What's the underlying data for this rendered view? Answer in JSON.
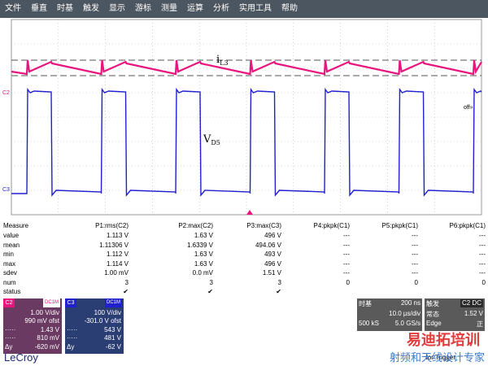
{
  "menu": [
    "文件",
    "垂直",
    "时基",
    "触发",
    "显示",
    "游标",
    "测量",
    "运算",
    "分析",
    "实用工具",
    "帮助"
  ],
  "waveform": {
    "label_current": "i",
    "label_current_sub": "L3",
    "label_voltage": "V",
    "label_voltage_sub": "D5",
    "ch2_marker": "C2",
    "ch3_marker": "C3",
    "offscreen_marker": "off",
    "colors": {
      "ch2": "#e8157e",
      "ch3": "#2020d0",
      "grid": "#808080",
      "dashed": "#555555",
      "trigger": "#e8157e"
    }
  },
  "measure": {
    "header": [
      "Measure",
      "P1:rms(C2)",
      "P2:max(C2)",
      "P3:max(C3)",
      "P4:pkpk(C1)",
      "P5:pkpk(C1)",
      "P6:pkpk(C1)"
    ],
    "rows": [
      [
        "value",
        "1.113 V",
        "1.63 V",
        "496 V",
        "---",
        "---",
        "---"
      ],
      [
        "mean",
        "1.11306 V",
        "1.6339 V",
        "494.06 V",
        "---",
        "---",
        "---"
      ],
      [
        "min",
        "1.112 V",
        "1.63 V",
        "493 V",
        "---",
        "---",
        "---"
      ],
      [
        "max",
        "1.114 V",
        "1.63 V",
        "496 V",
        "---",
        "---",
        "---"
      ],
      [
        "sdev",
        "1.00 mV",
        "0.0 mV",
        "1.51 V",
        "---",
        "---",
        "---"
      ],
      [
        "num",
        "3",
        "3",
        "3",
        "0",
        "0",
        "0"
      ],
      [
        "status",
        "✔",
        "✔",
        "✔",
        "",
        "",
        ""
      ]
    ]
  },
  "channels": {
    "c2": {
      "tag": "C2",
      "coupling": "DC1M",
      "vdiv": "1.00 V/div",
      "offset": "990 mV ofst",
      "r1_label": "·····",
      "r1": "1.43 V",
      "r2_label": "·····",
      "r2": "810 mV",
      "r3_label": "Δy",
      "r3": "-620 mV",
      "bg": "#6b3a63",
      "tag_bg": "#e8157e"
    },
    "c3": {
      "tag": "C3",
      "coupling": "DC1M",
      "vdiv": "100 V/div",
      "offset": "-301.0 V ofst",
      "r1_label": "·····",
      "r1": "543 V",
      "r2_label": "·····",
      "r2": "481 V",
      "r3_label": "Δy",
      "r3": "-62 V",
      "bg": "#2a3e74",
      "tag_bg": "#2020d0"
    }
  },
  "timebase": {
    "title": "时基",
    "value": "200 ns",
    "tdiv": "10.0 µs/div",
    "samples": "500 kS",
    "rate": "5.0 GS/s"
  },
  "trigger": {
    "title": "触发",
    "tag": "C2 DC",
    "mode": "常态",
    "level": "1.52 V",
    "type": "Edge",
    "slope": "正"
  },
  "footer": {
    "logo": "LeCroy",
    "status": "for Trigger",
    "watermark_brand": "易迪拓培训",
    "watermark": "射频和天线设计专家"
  }
}
